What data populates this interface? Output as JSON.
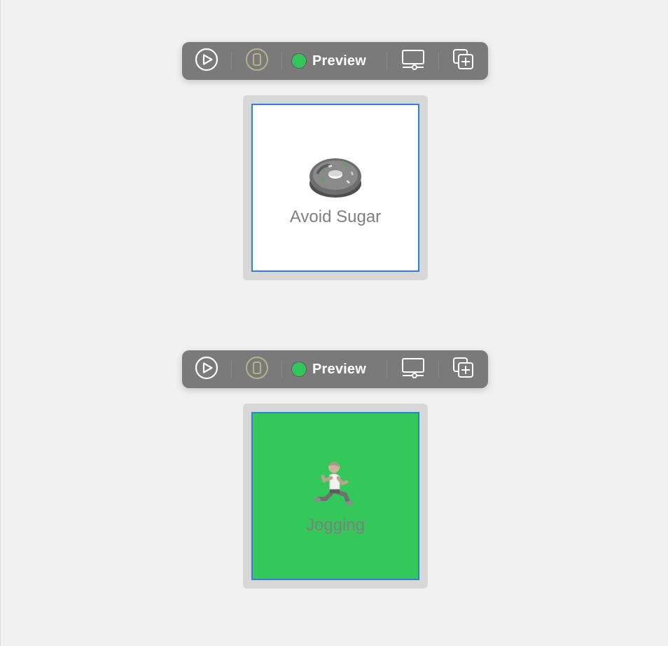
{
  "previews": [
    {
      "toolbar": {
        "play_icon": "play-circle-icon",
        "device_icon": "device-icon",
        "status_color": "#32c559",
        "preview_label": "Preview",
        "display_icon": "display-settings-icon",
        "duplicate_icon": "duplicate-icon"
      },
      "card": {
        "emoji": "doughnut",
        "title": "Avoid Sugar",
        "background": "#ffffff"
      }
    },
    {
      "toolbar": {
        "play_icon": "play-circle-icon",
        "device_icon": "device-icon",
        "status_color": "#32c559",
        "preview_label": "Preview",
        "display_icon": "display-settings-icon",
        "duplicate_icon": "duplicate-icon"
      },
      "card": {
        "emoji": "person-running",
        "title": "Jogging",
        "background": "#34c759"
      }
    }
  ],
  "colors": {
    "toolbar_bg": "#7a7a7a",
    "selection_border": "#2f7fd8",
    "canvas_bg": "#f1f1f1",
    "card_frame": "#d7d7d7"
  }
}
